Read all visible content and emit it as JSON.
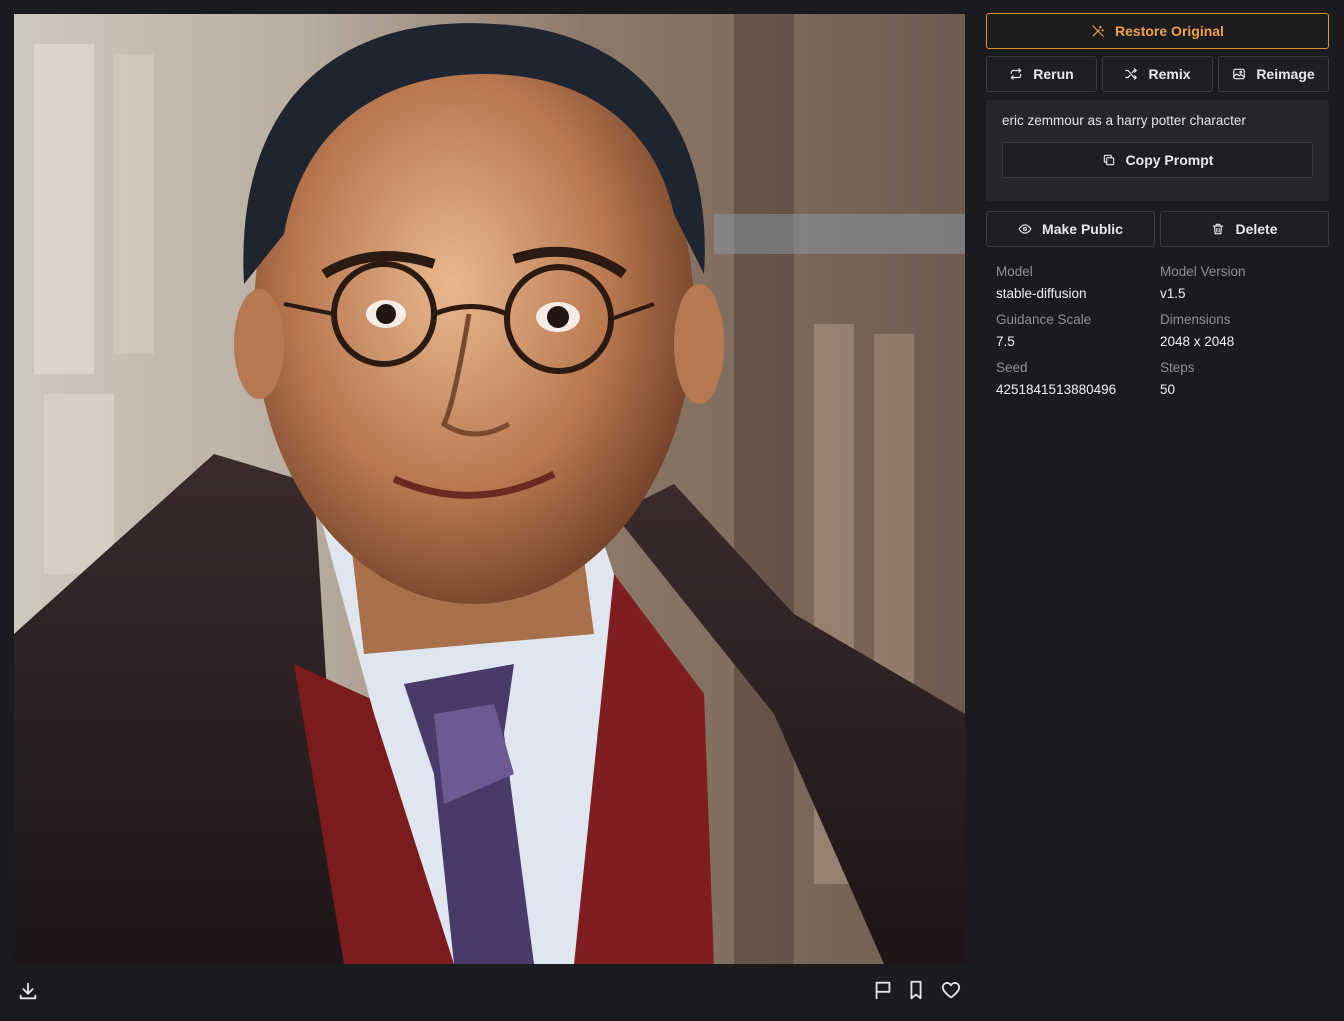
{
  "actions": {
    "restore_label": "Restore Original",
    "rerun_label": "Rerun",
    "remix_label": "Remix",
    "reimage_label": "Reimage",
    "copy_prompt_label": "Copy Prompt",
    "make_public_label": "Make Public",
    "delete_label": "Delete"
  },
  "prompt": "eric zemmour as a harry potter character",
  "metadata": {
    "model_label": "Model",
    "model_value": "stable-diffusion",
    "model_version_label": "Model Version",
    "model_version_value": "v1.5",
    "guidance_label": "Guidance Scale",
    "guidance_value": "7.5",
    "dimensions_label": "Dimensions",
    "dimensions_value": "2048 x 2048",
    "seed_label": "Seed",
    "seed_value": "4251841513880496",
    "steps_label": "Steps",
    "steps_value": "50"
  },
  "icons": {
    "restore": "wand-off-icon",
    "rerun": "repeat-icon",
    "remix": "shuffle-icon",
    "reimage": "image-icon",
    "copy": "copy-icon",
    "make_public": "eye-icon",
    "delete": "trash-icon",
    "download": "download-icon",
    "flag": "flag-icon",
    "bookmark": "bookmark-icon",
    "like": "heart-icon"
  },
  "colors": {
    "background": "#1a1b1e",
    "accent": "#e0913a",
    "panel": "#25262a"
  }
}
